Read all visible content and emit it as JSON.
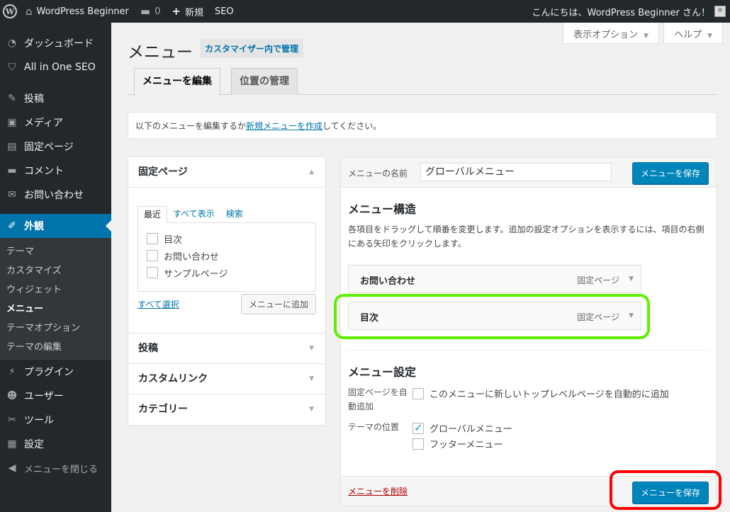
{
  "adminbar": {
    "site": "WordPress Beginner",
    "comments": "0",
    "new": "新規",
    "seo": "SEO",
    "greeting": "こんにちは、WordPress Beginner さん！"
  },
  "sidebar": {
    "items": [
      {
        "label": "ダッシュボード",
        "icon": "gauge-icon"
      },
      {
        "label": "All in One SEO",
        "icon": "shield-icon"
      },
      {
        "label": "投稿",
        "icon": "pin-icon"
      },
      {
        "label": "メディア",
        "icon": "media-icon"
      },
      {
        "label": "固定ページ",
        "icon": "page-icon"
      },
      {
        "label": "コメント",
        "icon": "comment-icon"
      },
      {
        "label": "お問い合わせ",
        "icon": "mail-icon"
      },
      {
        "label": "外観",
        "icon": "brush-icon"
      },
      {
        "label": "プラグイン",
        "icon": "plug-icon"
      },
      {
        "label": "ユーザー",
        "icon": "user-icon"
      },
      {
        "label": "ツール",
        "icon": "wrench-icon"
      },
      {
        "label": "設定",
        "icon": "settings-icon"
      },
      {
        "label": "メニューを閉じる",
        "icon": "collapse-icon"
      }
    ],
    "submenu": [
      "テーマ",
      "カスタマイズ",
      "ウィジェット",
      "メニュー",
      "テーマオプション",
      "テーマの編集"
    ]
  },
  "screen_meta": {
    "options": "表示オプション",
    "help": "ヘルプ"
  },
  "page": {
    "title": "メニュー",
    "customizer": "カスタマイザー内で管理",
    "tabs": [
      "メニューを編集",
      "位置の管理"
    ],
    "notice_before": "以下のメニューを編集するか",
    "notice_link": "新規メニューを作成",
    "notice_after": "してください。"
  },
  "left": {
    "pages_title": "固定ページ",
    "subtabs": [
      "最近",
      "すべて表示",
      "検索"
    ],
    "pages": [
      "目次",
      "お問い合わせ",
      "サンプルページ"
    ],
    "select_all": "すべて選択",
    "add_button": "メニューに追加",
    "sections": [
      "投稿",
      "カスタムリンク",
      "カテゴリー"
    ]
  },
  "right": {
    "name_label": "メニューの名前",
    "name_value": "グローバルメニュー",
    "save": "メニューを保存",
    "structure_title": "メニュー構造",
    "structure_desc": "各項目をドラッグして順番を変更します。追加の設定オプションを表示するには、項目の右側にある矢印をクリックします。",
    "items": [
      {
        "title": "お問い合わせ",
        "type": "固定ページ"
      },
      {
        "title": "目次",
        "type": "固定ページ"
      }
    ],
    "settings_title": "メニュー設定",
    "auto_add_label": "固定ページを自動追加",
    "auto_add_option": "このメニューに新しいトップレベルページを自動的に追加",
    "location_label": "テーマの位置",
    "locations": [
      {
        "label": "グローバルメニュー",
        "checked": true
      },
      {
        "label": "フッターメニュー",
        "checked": false
      }
    ],
    "delete": "メニューを削除"
  }
}
